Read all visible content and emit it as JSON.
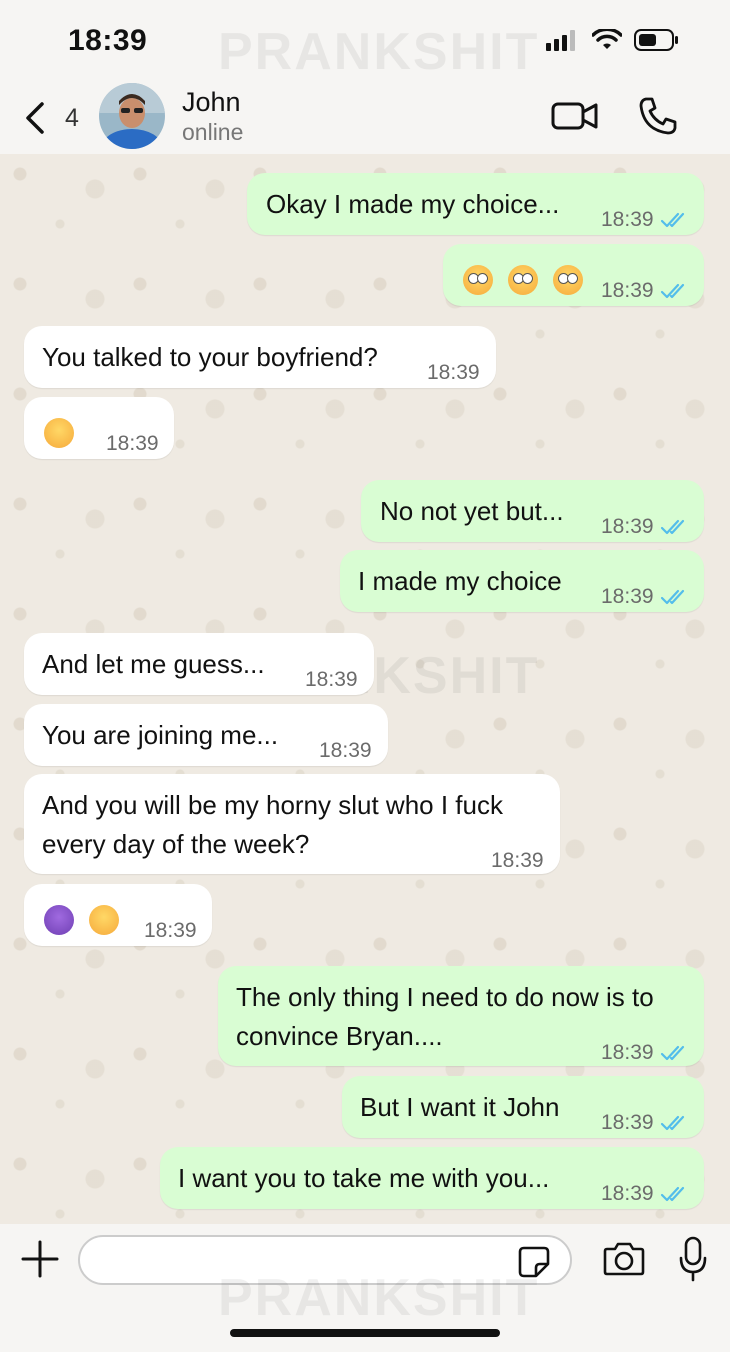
{
  "status_bar": {
    "time": "18:39"
  },
  "header": {
    "back_count": "4",
    "contact_name": "John",
    "contact_status": "online"
  },
  "watermark": "PRANKSHIT",
  "messages": [
    {
      "dir": "out",
      "text": "Okay I made my choice...",
      "time": "18:39",
      "read": true
    },
    {
      "dir": "out",
      "emojis": [
        "flushed-face",
        "flushed-face",
        "flushed-face"
      ],
      "time": "18:39",
      "read": true
    },
    {
      "dir": "in",
      "text": "You talked to your boyfriend?",
      "time": "18:39"
    },
    {
      "dir": "in",
      "emojis": [
        "zany-face"
      ],
      "time": "18:39"
    },
    {
      "dir": "out",
      "text": "No not yet but...",
      "time": "18:39",
      "read": true
    },
    {
      "dir": "out",
      "text": "I made my choice",
      "time": "18:39",
      "read": true
    },
    {
      "dir": "in",
      "text": "And let me guess...",
      "time": "18:39"
    },
    {
      "dir": "in",
      "text": "You are joining me...",
      "time": "18:39"
    },
    {
      "dir": "in",
      "lines": [
        "And you will be my horny slut who I fuck",
        "every day of the week?"
      ],
      "time": "18:39"
    },
    {
      "dir": "in",
      "emojis": [
        "smiling-face-with-horns",
        "woozy-face"
      ],
      "time": "18:39"
    },
    {
      "dir": "out",
      "lines": [
        "The only thing I need to do now is to",
        "convince Bryan...."
      ],
      "time": "18:39",
      "read": true
    },
    {
      "dir": "out",
      "text": "But I want it John",
      "time": "18:39",
      "read": true
    },
    {
      "dir": "out",
      "text": "I want you to take me with you...",
      "time": "18:39",
      "read": true
    }
  ],
  "colors": {
    "outgoing_bubble": "#d9fdd3",
    "incoming_bubble": "#ffffff",
    "read_check": "#53bdeb",
    "chat_background": "#efeae2"
  },
  "icons": {
    "back": "chevron-left-icon",
    "video": "video-camera-icon",
    "phone": "phone-icon",
    "plus": "plus-icon",
    "sticker": "sticker-icon",
    "camera": "camera-icon",
    "mic": "microphone-icon"
  }
}
